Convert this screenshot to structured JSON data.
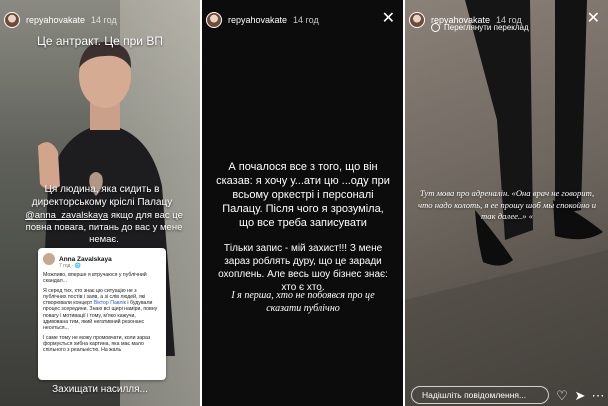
{
  "panel1": {
    "username": "repyahovakate",
    "time": "14 год",
    "caption_top": "Це антракт. Це при ВП",
    "caption_mid": "Ця людина, яка сидить в директорському кріслі Палацу",
    "mention": "@anna_zavalskaya",
    "caption_mention_rest": " якщо для вас це повна повага, питань до вас у мене немає.",
    "post": {
      "author": "Anna Zavalskaya",
      "meta": "7 год · 🌐",
      "p1": "Можливо, вперше я втручаюся у публічний скандал...",
      "p2_before": "Я серед тих, хто знає цю ситуацію не з публічних постів і заяв, а зі слів людей, які створювали концерт ",
      "p2_link": "Віктор Павлік",
      "p2_after": " і будували процес зсередини. Знаю всі щирі наміри, повну повагу і мотивації і тому, м'яко кажучи, здивована тим, який негативний резонанс несеться...",
      "p3": "І саме тому не можу промовчати, коли зараз формується хибна картина, яка має мало спільного з реальністю. На жаль"
    },
    "caption_bottom": "Захищати насилля..."
  },
  "panel2": {
    "username": "repyahovakate",
    "time": "14 год",
    "main": "А почалося все з того, що він сказав: я хочу у...ати цю ...оду при всьому оркестрі і персоналі Палацу. Після чого я зрозуміла, що все треба записувати",
    "sub": "Тільки запис - мій захист!!! З мене зараз роблять дуру, що це заради охоплень. Але весь шоу бізнес знає: хто є хто.",
    "italic": "І я перша, хто не побоявся про це сказати публічно"
  },
  "panel3": {
    "username": "repyahovakate",
    "time": "14 год",
    "translate_label": "Переглянути переклад",
    "text": "Тут мова про адреналін. «Она врач не говорит, что надо колоть, я ее прошу шоб мы спокойно и так далее..» «",
    "reply_placeholder": "Надішліть повідомлення..."
  },
  "icons": {
    "close": "close-icon",
    "heart": "heart-icon",
    "send": "send-icon",
    "more": "more-icon",
    "globe": "globe-icon"
  }
}
